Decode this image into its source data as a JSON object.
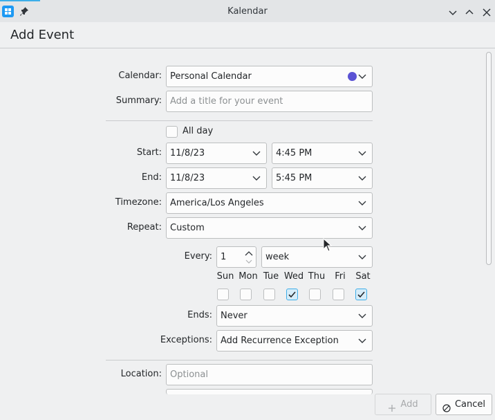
{
  "window": {
    "title": "Kalendar",
    "icons": [
      "kalendar-app-icon",
      "pin-icon",
      "minimize-icon",
      "maximize-icon",
      "close-icon"
    ]
  },
  "header": {
    "title": "Add Event"
  },
  "form": {
    "calendar": {
      "label": "Calendar:",
      "value": "Personal Calendar",
      "color": "#5b53d4"
    },
    "summary": {
      "label": "Summary:",
      "placeholder": "Add a title for your event"
    },
    "all_day": {
      "label": "All day",
      "checked": false
    },
    "start": {
      "label": "Start:",
      "date": "11/8/23",
      "time": "4:45 PM"
    },
    "end": {
      "label": "End:",
      "date": "11/8/23",
      "time": "5:45 PM"
    },
    "timezone": {
      "label": "Timezone:",
      "value": "America/Los Angeles"
    },
    "repeat": {
      "label": "Repeat:",
      "value": "Custom"
    },
    "every": {
      "label": "Every:",
      "value": "1",
      "unit": "week"
    },
    "days": [
      {
        "name": "Sun",
        "checked": false
      },
      {
        "name": "Mon",
        "checked": false
      },
      {
        "name": "Tue",
        "checked": false
      },
      {
        "name": "Wed",
        "checked": true
      },
      {
        "name": "Thu",
        "checked": false
      },
      {
        "name": "Fri",
        "checked": false
      },
      {
        "name": "Sat",
        "checked": true
      }
    ],
    "ends": {
      "label": "Ends:",
      "value": "Never"
    },
    "exceptions": {
      "label": "Exceptions:",
      "value": "Add Recurrence Exception"
    },
    "location": {
      "label": "Location:",
      "placeholder": "Optional"
    }
  },
  "footer": {
    "add_label": "Add",
    "cancel_label": "Cancel"
  },
  "colors": {
    "accent": "#3daee9",
    "calendar_dot": "#5b53d4"
  }
}
